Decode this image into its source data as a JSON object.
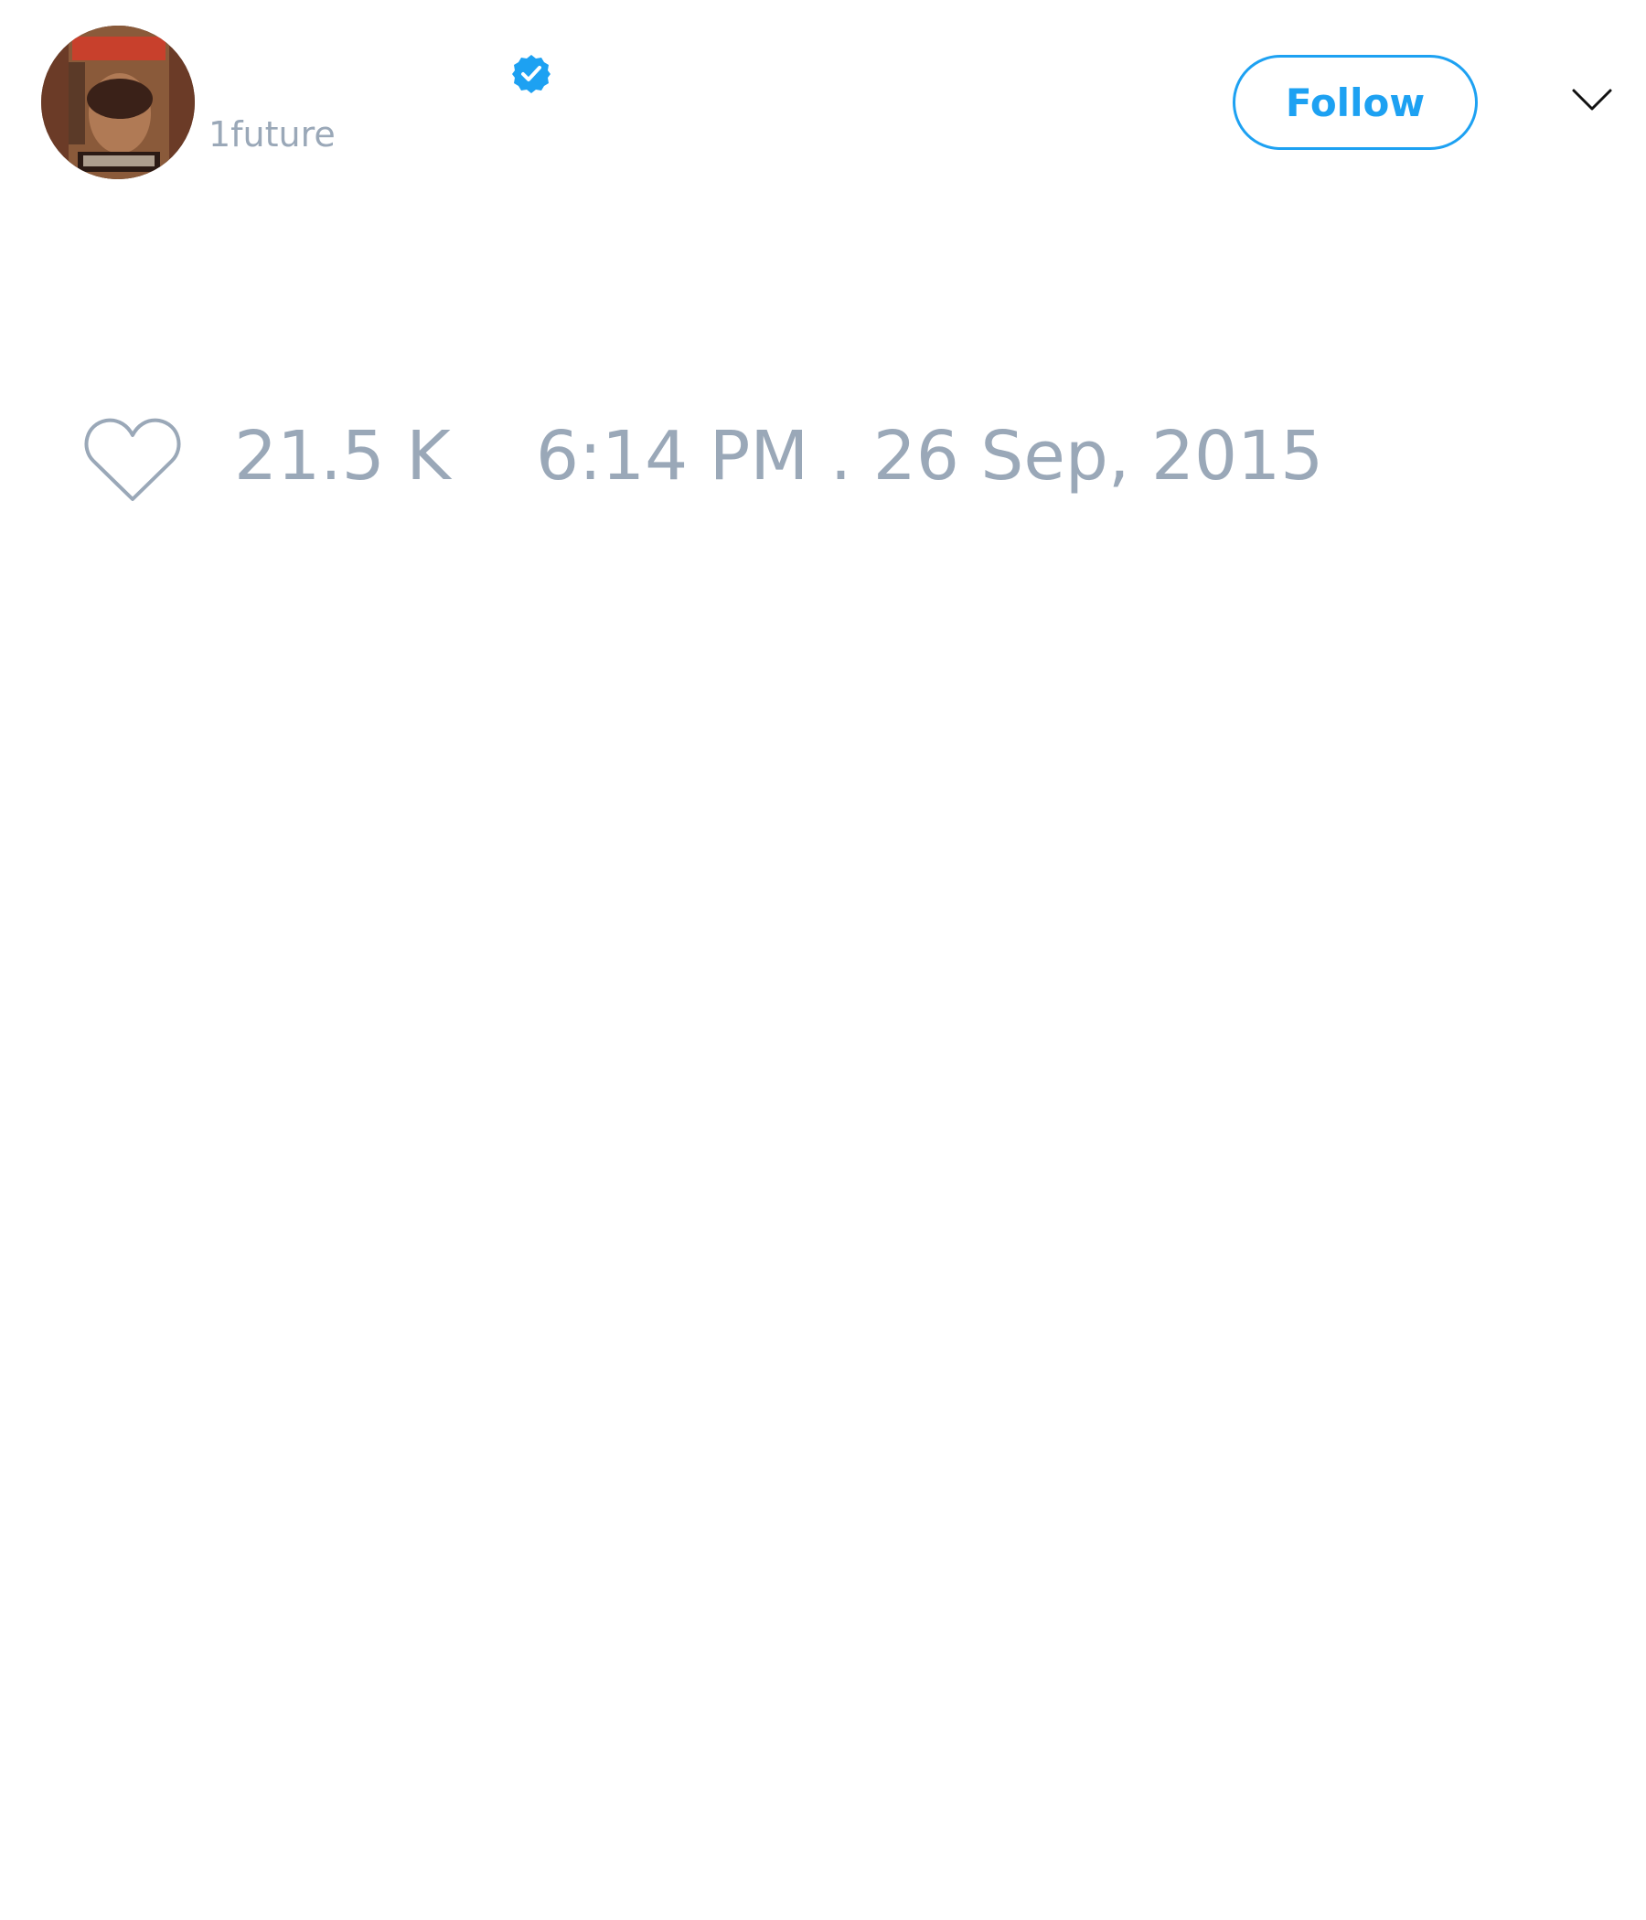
{
  "user": {
    "handle": "1future",
    "verified": true,
    "avatar_icon": "profile-photo-magazine-cover"
  },
  "actions": {
    "follow_label": "Follow",
    "menu_icon": "chevron-down-icon"
  },
  "stats": {
    "like_icon": "heart-icon",
    "like_count": "21.5 K",
    "timestamp": "6:14 PM . 26 Sep, 2015"
  },
  "colors": {
    "accent": "#1da1f2",
    "muted_text": "#9aa8b8",
    "background": "#ffffff"
  }
}
